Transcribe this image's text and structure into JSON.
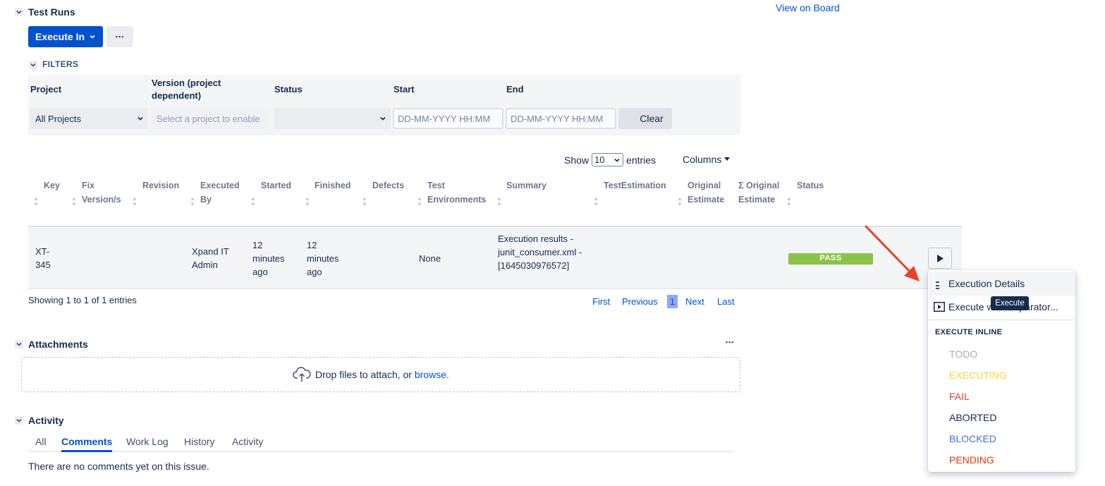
{
  "test_runs": {
    "title": "Test Runs",
    "view_on_board": "View on Board",
    "execute_in_label": "Execute In",
    "more_label": "•••"
  },
  "filters": {
    "title": "FILTERS",
    "project_label": "Project",
    "project_value": "All Projects",
    "version_label": "Version (project dependent)",
    "version_placeholder": "Select a project to enable",
    "status_label": "Status",
    "start_label": "Start",
    "start_placeholder": "DD-MM-YYYY HH:MM",
    "end_label": "End",
    "end_placeholder": "DD-MM-YYYY HH:MM",
    "clear_label": "Clear"
  },
  "table_controls": {
    "show_label": "Show",
    "entries_value": "10",
    "entries_label": "entries",
    "columns_label": "Columns"
  },
  "table": {
    "headers": [
      "Key",
      "Fix Version/s",
      "Revision",
      "Executed By",
      "Started",
      "Finished",
      "Defects",
      "Test Environments",
      "Summary",
      "TestEstimation",
      "Original Estimate",
      "Σ Original Estimate",
      "Status"
    ],
    "row": {
      "key": "XT-345",
      "executed_by": "Xpand IT Admin",
      "started": "12 minutes ago",
      "finished": "12 minutes ago",
      "test_environments": "None",
      "summary": "Execution results - junit_consumer.xml - [1645030976572]",
      "status": "PASS",
      "status_color": "#8bc34a"
    }
  },
  "pagination": {
    "showing_text": "Showing 1 to 1 of 1 entries",
    "first": "First",
    "previous": "Previous",
    "current_page": "1",
    "next": "Next",
    "last": "Last"
  },
  "dropdown_menu": {
    "execution_details": "Execution Details",
    "execute_with": "Execute with Separator...",
    "tooltip": "Execute",
    "execute_inline_heading": "EXECUTE INLINE",
    "statuses": [
      {
        "label": "TODO",
        "color": "#a5adba"
      },
      {
        "label": "EXECUTING",
        "color": "#f1d63a"
      },
      {
        "label": "FAIL",
        "color": "#d04437"
      },
      {
        "label": "ABORTED",
        "color": "#172b4d"
      },
      {
        "label": "BLOCKED",
        "color": "#4a6cd8"
      },
      {
        "label": "PENDING",
        "color": "#de350b"
      }
    ]
  },
  "attachments": {
    "title": "Attachments",
    "drop_text": "Drop files to attach, or ",
    "browse_link": "browse",
    "period": "."
  },
  "activity": {
    "title": "Activity",
    "tabs": [
      "All",
      "Comments",
      "Work Log",
      "History",
      "Activity"
    ],
    "active_tab": "Comments",
    "empty_text": "There are no comments yet on this issue."
  },
  "colors": {
    "primary": "#0052cc",
    "arrow": "#e8412b"
  }
}
